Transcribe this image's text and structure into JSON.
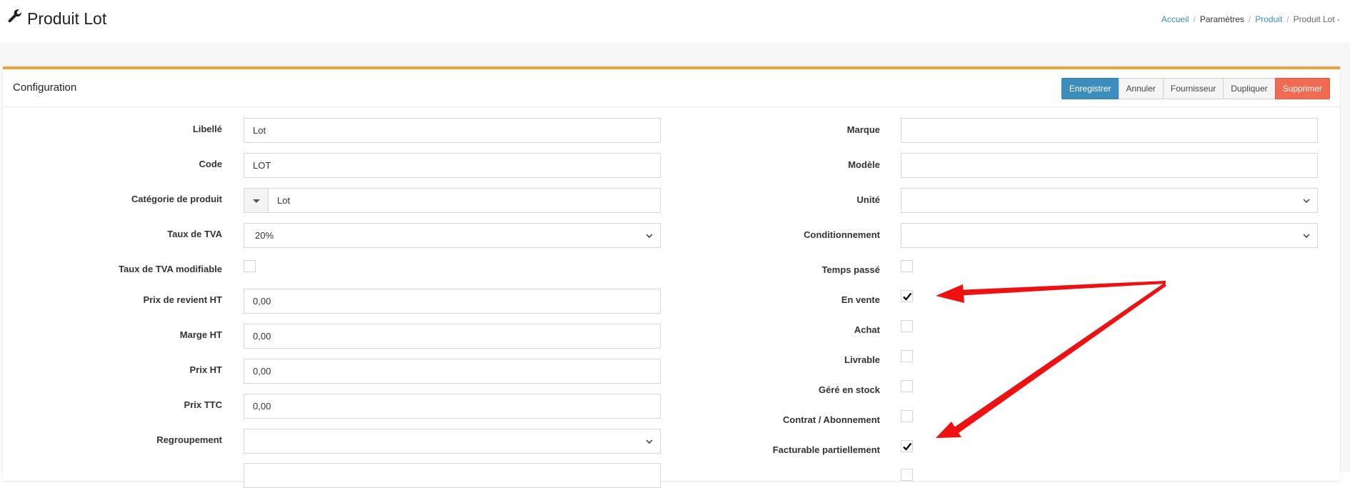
{
  "header": {
    "title": "Produit Lot"
  },
  "breadcrumb": {
    "home": "Accueil",
    "params": "Paramètres",
    "product": "Produit",
    "current": "Produit Lot -"
  },
  "box": {
    "title": "Configuration"
  },
  "buttons": {
    "save": "Enregistrer",
    "cancel": "Annuler",
    "supplier": "Fournisseur",
    "duplicate": "Dupliquer",
    "delete": "Supprimer"
  },
  "left": {
    "libelle_label": "Libellé",
    "libelle_value": "Lot",
    "code_label": "Code",
    "code_value": "LOT",
    "categorie_label": "Catégorie de produit",
    "categorie_value": "Lot",
    "tva_label": "Taux de TVA",
    "tva_value": "20%",
    "tva_mod_label": "Taux de TVA modifiable",
    "prix_revient_label": "Prix de revient HT",
    "prix_revient_value": "0,00",
    "marge_label": "Marge HT",
    "marge_value": "0,00",
    "prix_ht_label": "Prix HT",
    "prix_ht_value": "0,00",
    "prix_ttc_label": "Prix TTC",
    "prix_ttc_value": "0,00",
    "regroupement_label": "Regroupement",
    "regroupement_value": ""
  },
  "right": {
    "marque_label": "Marque",
    "marque_value": "",
    "modele_label": "Modèle",
    "modele_value": "",
    "unite_label": "Unité",
    "unite_value": "",
    "conditionnement_label": "Conditionnement",
    "conditionnement_value": "",
    "temps_passe_label": "Temps passé",
    "temps_passe_checked": false,
    "en_vente_label": "En vente",
    "en_vente_checked": true,
    "achat_label": "Achat",
    "achat_checked": false,
    "livrable_label": "Livrable",
    "livrable_checked": false,
    "gere_stock_label": "Géré en stock",
    "gere_stock_checked": false,
    "contrat_label": "Contrat / Abonnement",
    "contrat_checked": false,
    "facturable_label": "Facturable partiellement",
    "facturable_checked": true
  },
  "colors": {
    "accent": "#3c8dbc",
    "danger": "#f06b53",
    "box_border": "#f0a33a",
    "annotation": "#ee1111"
  },
  "icons": {
    "title_icon": "wrench-icon",
    "check": "check-icon",
    "caret": "chevron-down-icon"
  }
}
